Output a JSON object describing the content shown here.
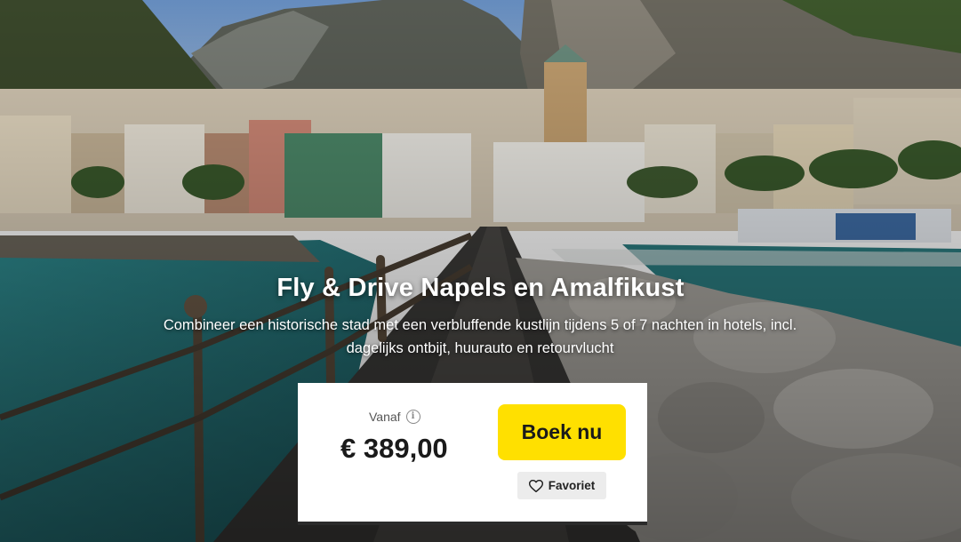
{
  "hero": {
    "title": "Fly & Drive Napels en Amalfikust",
    "subtitle": "Combineer een historische stad met een verbluffende kustlijn tijdens 5 of 7 nachten in hotels, incl. dagelijks ontbijt, huurauto en retourvlucht"
  },
  "price_card": {
    "from_label": "Vanaf",
    "price": "€ 389,00",
    "book_label": "Boek nu",
    "favorite_label": "Favoriet"
  },
  "icons": {
    "info": "info-icon",
    "heart": "heart-outline-icon"
  },
  "colors": {
    "book_button": "#ffe000",
    "favorite_button": "#ececec"
  }
}
